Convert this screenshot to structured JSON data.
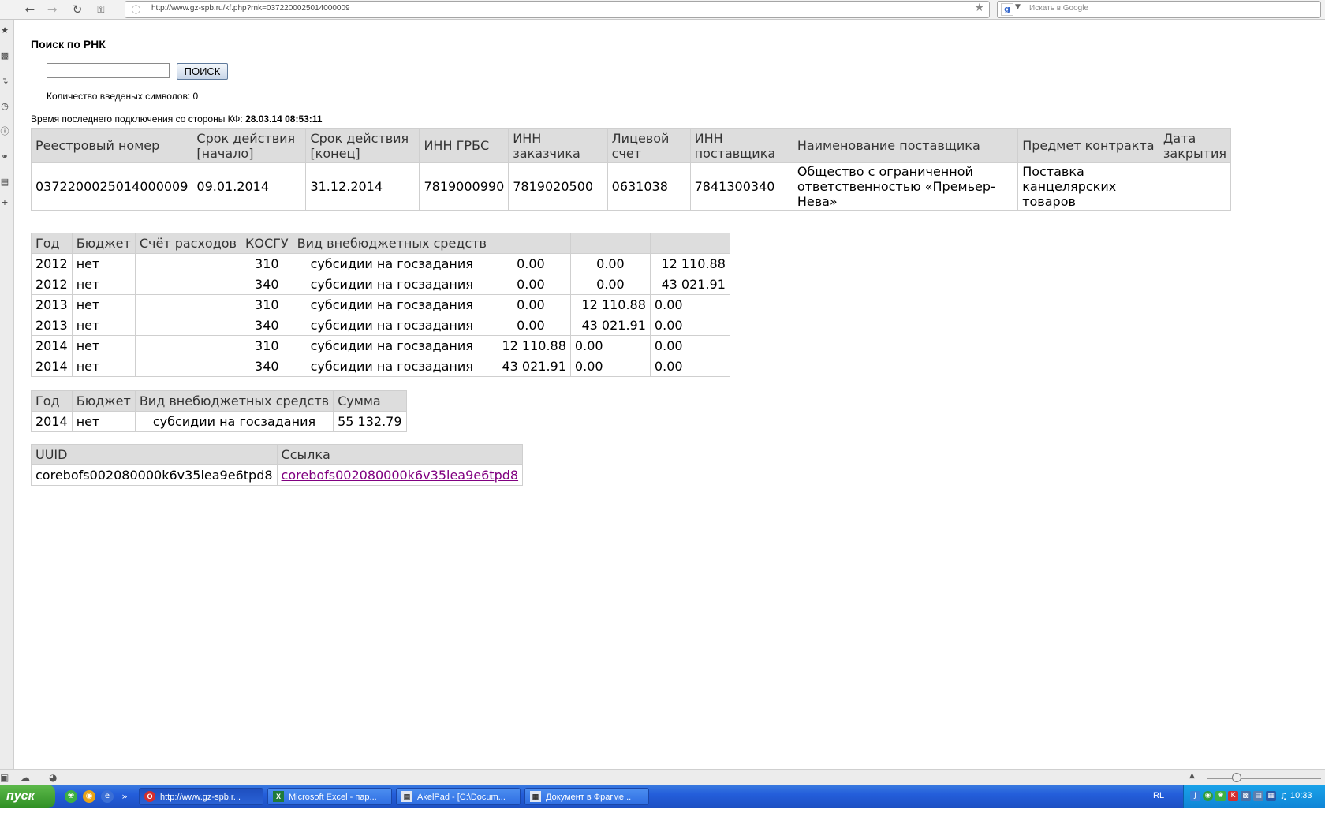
{
  "browser": {
    "url": "http://www.gz-spb.ru/kf.php?rnk=0372200025014000009",
    "search_placeholder": "Искать в Google"
  },
  "page": {
    "title": "Поиск по РНК",
    "search_button": "ПОИСК",
    "search_value": "",
    "char_count": "Количество введеных символов: 0",
    "last_connection_label": "Время последнего подключения со стороны КФ:",
    "last_connection_value": "28.03.14 08:53:11"
  },
  "contract": {
    "headers": [
      "Реестровый номер",
      "Срок действия [начало]",
      "Срок действия [конец]",
      "ИНН ГРБС",
      "ИНН заказчика",
      "Лицевой счет",
      "ИНН поставщика",
      "Наименование поставщика",
      "Предмет контракта",
      "Дата закрытия"
    ],
    "row": [
      "0372200025014000009",
      "09.01.2014",
      "31.12.2014",
      "7819000990",
      "7819020500",
      "0631038",
      "7841300340",
      "Общество с ограниченной ответственностью «Премьер-Нева»",
      "Поставка канцелярских товаров",
      ""
    ]
  },
  "finance": {
    "headers": [
      "Год",
      "Бюджет",
      "Счёт расходов",
      "КОСГУ",
      "Вид внебюджетных средств",
      "",
      "",
      ""
    ],
    "rows": [
      [
        "2012",
        "нет",
        "",
        "310",
        "субсидии на госзадания",
        "0.00",
        "0.00",
        "12 110.88"
      ],
      [
        "2012",
        "нет",
        "",
        "340",
        "субсидии на госзадания",
        "0.00",
        "0.00",
        "43 021.91"
      ],
      [
        "2013",
        "нет",
        "",
        "310",
        "субсидии на госзадания",
        "0.00",
        "12 110.88",
        "0.00"
      ],
      [
        "2013",
        "нет",
        "",
        "340",
        "субсидии на госзадания",
        "0.00",
        "43 021.91",
        "0.00"
      ],
      [
        "2014",
        "нет",
        "",
        "310",
        "субсидии на госзадания",
        "12 110.88",
        "0.00",
        "0.00"
      ],
      [
        "2014",
        "нет",
        "",
        "340",
        "субсидии на госзадания",
        "43 021.91",
        "0.00",
        "0.00"
      ]
    ]
  },
  "summary": {
    "headers": [
      "Год",
      "Бюджет",
      "Вид внебюджетных средств",
      "Сумма"
    ],
    "row": [
      "2014",
      "нет",
      "субсидии на госзадания",
      "55 132.79"
    ]
  },
  "uuid": {
    "headers": [
      "UUID",
      "Ссылка"
    ],
    "value": "corebofs002080000k6v35lea9e6tpd8",
    "link": "corebofs002080000k6v35lea9e6tpd8"
  },
  "taskbar": {
    "start": "пуск",
    "tasks": [
      "http://www.gz-spb.r...",
      "Microsoft Excel - пар...",
      "AkelPad - [C:\\Docum...",
      "Документ в Фрагме..."
    ],
    "lang": "RL",
    "clock": "10:33"
  }
}
